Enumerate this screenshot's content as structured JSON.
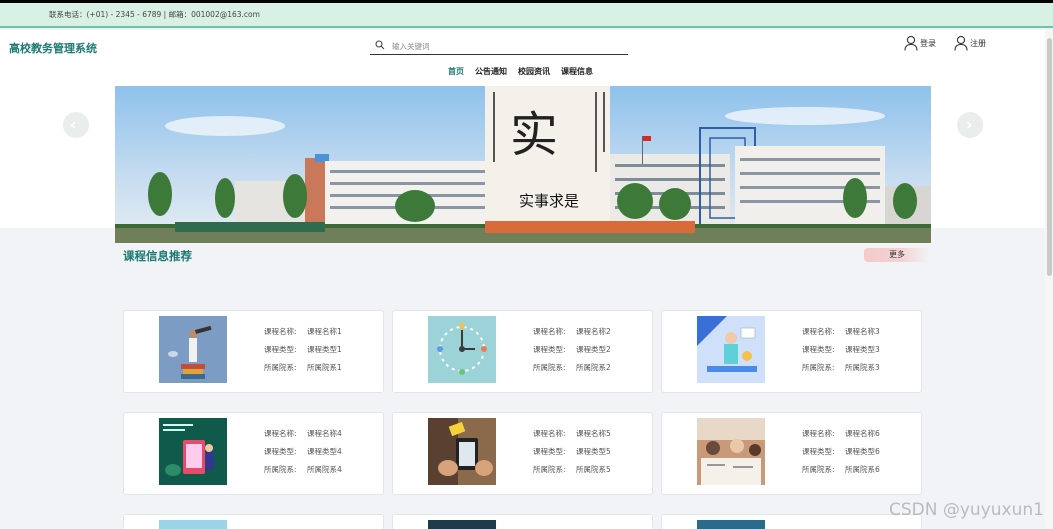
{
  "contact": {
    "text": "联系电话：(+01) - 2345 - 6789  |  邮箱：001002@163.com"
  },
  "header": {
    "title": "高校教务管理系统",
    "search_placeholder": "输入关键词",
    "login_label": "登录",
    "register_label": "注册"
  },
  "nav": {
    "items": [
      {
        "label": "首页",
        "active": true
      },
      {
        "label": "公告通知",
        "active": false
      },
      {
        "label": "校园资讯",
        "active": false
      },
      {
        "label": "课程信息",
        "active": false
      }
    ]
  },
  "banner": {
    "caption": "实事求是",
    "big_glyph": "实"
  },
  "section": {
    "title": "课程信息推荐",
    "more_label": "更多"
  },
  "courses": [
    {
      "name_label": "课程名称:",
      "name": "课程名称1",
      "type_label": "课程类型:",
      "type": "课程类型1",
      "dept_label": "所属院系:",
      "dept": "所属院系1"
    },
    {
      "name_label": "课程名称:",
      "name": "课程名称2",
      "type_label": "课程类型:",
      "type": "课程类型2",
      "dept_label": "所属院系:",
      "dept": "所属院系2"
    },
    {
      "name_label": "课程名称:",
      "name": "课程名称3",
      "type_label": "课程类型:",
      "type": "课程类型3",
      "dept_label": "所属院系:",
      "dept": "所属院系3"
    },
    {
      "name_label": "课程名称:",
      "name": "课程名称4",
      "type_label": "课程类型:",
      "type": "课程类型4",
      "dept_label": "所属院系:",
      "dept": "所属院系4"
    },
    {
      "name_label": "课程名称:",
      "name": "课程名称5",
      "type_label": "课程类型:",
      "type": "课程类型5",
      "dept_label": "所属院系:",
      "dept": "所属院系5"
    },
    {
      "name_label": "课程名称:",
      "name": "课程名称6",
      "type_label": "课程类型:",
      "type": "课程类型6",
      "dept_label": "所属院系:",
      "dept": "所属院系6"
    }
  ],
  "watermark": "CSDN @yuyuxun1",
  "colors": {
    "brand": "#1d7a73",
    "contact_bar": "#d9f1e4",
    "page_bg": "#f2f3f6"
  }
}
